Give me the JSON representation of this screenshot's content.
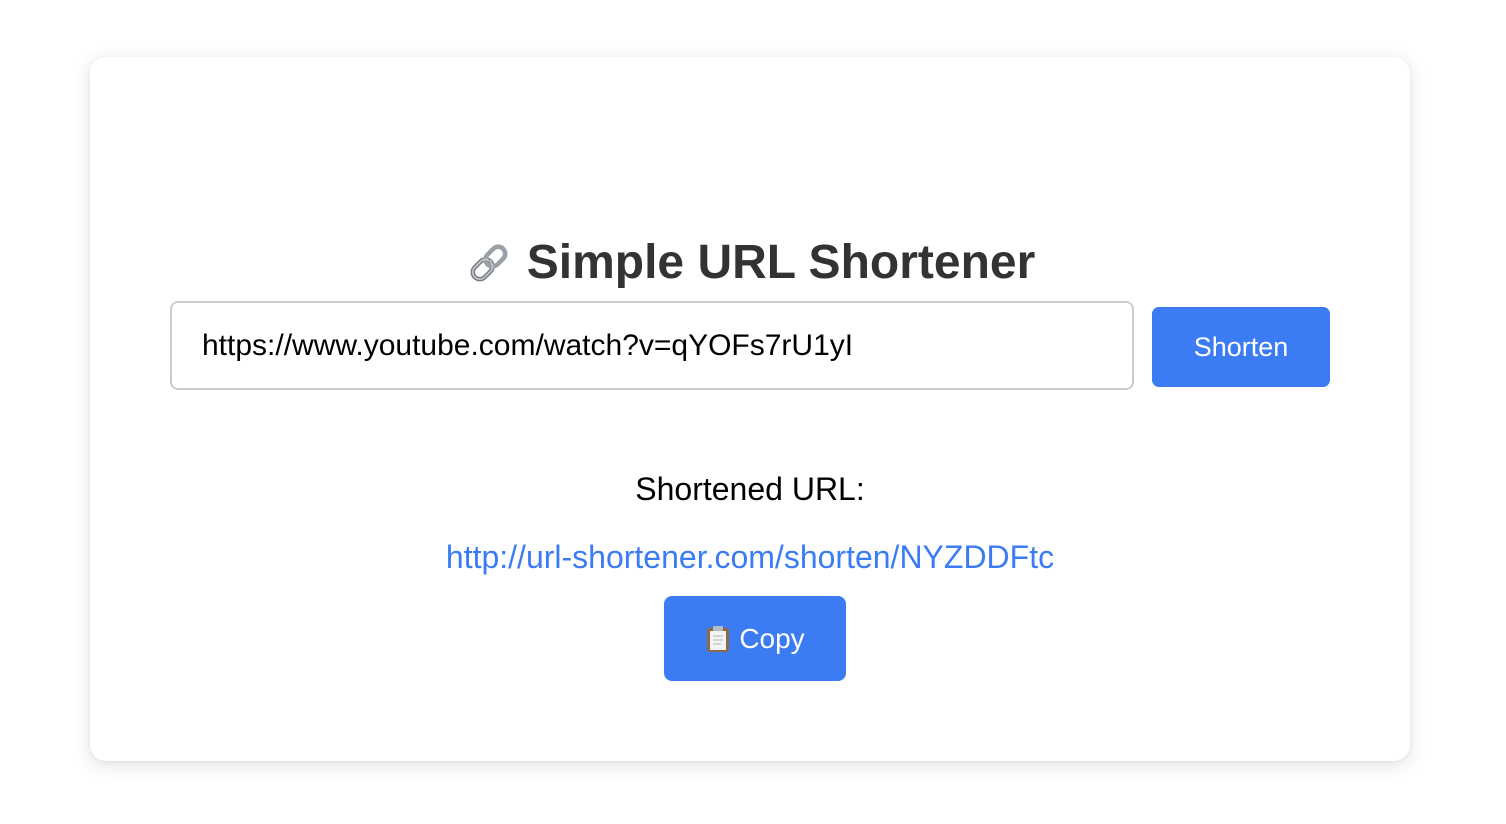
{
  "header": {
    "title": "Simple URL Shortener",
    "icon": "link-icon"
  },
  "form": {
    "url_value": "https://www.youtube.com/watch?v=qYOFs7rU1yI",
    "shorten_label": "Shorten"
  },
  "result": {
    "label": "Shortened URL:",
    "short_url": "http://url-shortener.com/shorten/NYZDDFtc",
    "copy_label": "Copy",
    "copy_icon": "clipboard-icon"
  },
  "colors": {
    "accent": "#3b7cf5",
    "title": "#333333",
    "input_border": "#cccccc"
  }
}
